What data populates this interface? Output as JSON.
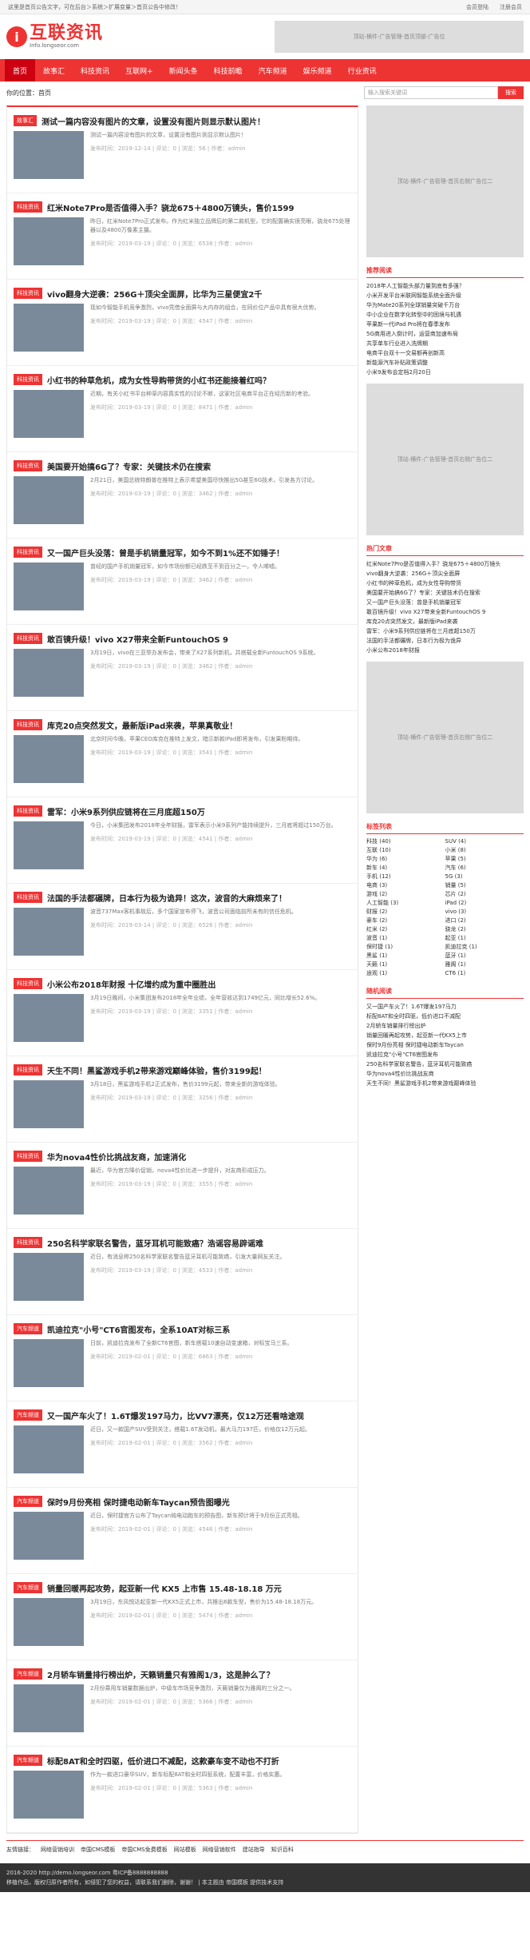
{
  "topbar": {
    "left": "这里是首页公告文字，可在后台＞系统＞扩展变量＞首页公告中修改！",
    "login": "会员登陆",
    "reg": "注册会员"
  },
  "logo": {
    "mark": "i",
    "cn": "互联资讯",
    "en": "Info.longseor.com"
  },
  "ads": {
    "top": "顶站-横件-广告管理-首页顶部-广告位",
    "side": "顶站-横件-广告管理-首页右侧广告位二"
  },
  "nav": [
    "首页",
    "故事汇",
    "科技资讯",
    "互联网+",
    "新闻头条",
    "科技前瞻",
    "汽车频道",
    "娱乐频道",
    "行业资讯"
  ],
  "bread": "你的位置：首页",
  "search": {
    "placeholder": "输入搜索关键词",
    "button": "搜索"
  },
  "articles": [
    {
      "badge": "故事汇",
      "title": "测试一篇内容没有图片的文章，设置没有图片则显示默认图片！",
      "desc": "测试一篇内容没有图片的文章，设置没有图片则显示默认图片！",
      "meta": "发布时间：2019-12-14 | 评论：0 | 浏览：56 | 作者：admin"
    },
    {
      "badge": "科技资讯",
      "title": "红米Note7Pro是否值得入手？骁龙675＋4800万镜头，售价1599",
      "desc": "昨日，红米Note7Pro正式发布。作为红米独立品牌后的第二款机型，它的配置确实很亮眼，骁龙675处理器以及4800万像素主摄。",
      "meta": "发布时间：2019-03-19 | 评论：0 | 浏览：6538 | 作者：admin"
    },
    {
      "badge": "科技资讯",
      "title": "vivo翻身大逆袭：256G＋顶尖全面屏，比华为三星便宜2千",
      "desc": "现如今智能手机竞争激烈，vivo凭借全面屏与大内存的组合，在同价位产品中具有很大优势。",
      "meta": "发布时间：2019-03-19 | 评论：0 | 浏览：4547 | 作者：admin"
    },
    {
      "badge": "科技资讯",
      "title": "小红书的种草危机，成为女性导购带货的小红书还能接着红吗？",
      "desc": "近期，有关小红书平台种草内容真实性的讨论不断，这家社区电商平台正在经历新的考验。",
      "meta": "发布时间：2019-03-19 | 评论：0 | 浏览：8471 | 作者：admin"
    },
    {
      "badge": "科技资讯",
      "title": "美国要开始搞6G了？专家：关键技术仍在搜索",
      "desc": "2月21日，美国总统特朗普在推特上表示希望美国尽快推出5G甚至6G技术，引发各方讨论。",
      "meta": "发布时间：2019-03-19 | 评论：0 | 浏览：3462 | 作者：admin"
    },
    {
      "badge": "科技资讯",
      "title": "又一国产巨头没落：曾是手机销量冠军，如今不到1%还不如锤子！",
      "desc": "曾经的国产手机销量冠军，如今市场份额已经跌至不到百分之一，令人唏嘘。",
      "meta": "发布时间：2019-03-19 | 评论：0 | 浏览：3462 | 作者：admin"
    },
    {
      "badge": "科技资讯",
      "title": "敢百镜升级！vivo X27带来全新FuntouchOS 9",
      "desc": "3月19日，vivo在三亚举办发布会，带来了X27系列新机，并搭载全新FuntouchOS 9系统。",
      "meta": "发布时间：2019-03-19 | 评论：0 | 浏览：3462 | 作者：admin"
    },
    {
      "badge": "科技资讯",
      "title": "库克20点突然发文，最新版iPad来袭，苹果真敬业！",
      "desc": "北京时间今晚，苹果CEO库克在推特上发文，暗示新款iPad即将发布，引发果粉期待。",
      "meta": "发布时间：2019-03-19 | 评论：0 | 浏览：3541 | 作者：admin"
    },
    {
      "badge": "科技资讯",
      "title": "雷军：小米9系列供应链将在三月底超150万",
      "desc": "今日，小米集团发布2018年全年财报，雷军表示小米9系列产能持续提升，三月底将超过150万台。",
      "meta": "发布时间：2019-03-19 | 评论：0 | 浏览：4541 | 作者：admin"
    },
    {
      "badge": "科技资讯",
      "title": "法国的手法都碾牌，日本行为极为诡异！这次，波音的大麻烦来了！",
      "desc": "波音737Max客机事故后，多个国家宣布停飞，波音公司面临前所未有的信任危机。",
      "meta": "发布时间：2019-03-14 | 评论：0 | 浏览：6526 | 作者：admin"
    },
    {
      "badge": "科技资讯",
      "title": "小米公布2018年财报 十亿增约成为重中圈胜出",
      "desc": "3月19日晚间，小米集团发布2018年全年业绩，全年营收达到1749亿元，同比增长52.6%。",
      "meta": "发布时间：2019-03-19 | 评论：0 | 浏览：3351 | 作者：admin"
    },
    {
      "badge": "科技资讯",
      "title": "天生不同！黑鲨游戏手机2带来游戏巅峰体验，售价3199起！",
      "desc": "3月18日，黑鲨游戏手机2正式发布，售价3199元起，带来全新的游戏体验。",
      "meta": "发布时间：2019-03-19 | 评论：0 | 浏览：3256 | 作者：admin"
    },
    {
      "badge": "科技资讯",
      "title": "华为nova4性价比挑战友商，加速消化",
      "desc": "最近，华为官方降价促销，nova4性价比进一步提升，对友商形成压力。",
      "meta": "发布时间：2019-03-19 | 评论：0 | 浏览：3555 | 作者：admin"
    },
    {
      "badge": "科技资讯",
      "title": "250名科学家联名警告，蓝牙耳机可能致癌？浩谣容易辟谣难",
      "desc": "近日，有消息称250名科学家联名警告蓝牙耳机可能致癌，引发大量网友关注。",
      "meta": "发布时间：2019-03-19 | 评论：0 | 浏览：4533 | 作者：admin"
    },
    {
      "badge": "汽车频道",
      "title": "凯迪拉克\"小号\"CT6官图发布，全系10AT对标三系",
      "desc": "日前，凯迪拉克发布了全新CT6官图，新车搭载10速自动变速箱，对标宝马三系。",
      "meta": "发布时间：2019-02-01 | 评论：0 | 浏览：6863 | 作者：admin"
    },
    {
      "badge": "汽车频道",
      "title": "又一国产车火了！1.6T爆发197马力，比VV7漂亮，仅12万还看啥途观",
      "desc": "近日，又一款国产SUV受到关注，搭载1.6T发动机，最大马力197匹，价格仅12万元起。",
      "meta": "发布时间：2019-02-01 | 评论：0 | 浏览：3562 | 作者：admin"
    },
    {
      "badge": "汽车频道",
      "title": "保时9月份亮相 保时捷电动新车Taycan预告图曝光",
      "desc": "近日，保时捷官方公布了Taycan纯电动跑车的预告图，新车预计将于9月份正式亮相。",
      "meta": "发布时间：2019-02-01 | 评论：0 | 浏览：4546 | 作者：admin"
    },
    {
      "badge": "汽车频道",
      "title": "销量回暖再起攻势，起亚新一代 KX5 上市售 15.48-18.18 万元",
      "desc": "3月19日，东风悦达起亚新一代KX5正式上市，共推出6款车型，售价为15.48-18.18万元。",
      "meta": "发布时间：2019-02-01 | 评论：0 | 浏览：5474 | 作者：admin"
    },
    {
      "badge": "汽车频道",
      "title": "2月轿车销量排行榜出炉，天籁销量只有雅阁1/3，这是肿么了？",
      "desc": "2月份乘用车销量数据出炉，中级车市场竞争激烈，天籁销量仅为雅阁的三分之一。",
      "meta": "发布时间：2019-02-01 | 评论：0 | 浏览：5366 | 作者：admin"
    },
    {
      "badge": "汽车频道",
      "title": "标配8AT和全时四驱，低价进口不减配，这款豪车变不动也不打折",
      "desc": "作为一款进口豪华SUV，新车标配8AT和全时四驱系统，配置丰富，价格实惠。",
      "meta": "发布时间：2019-02-01 | 评论：0 | 浏览：5363 | 作者：admin"
    }
  ],
  "side": {
    "recommend_title": "推荐阅读",
    "recommend": [
      "2018年人工智能头部力量到底有多强？",
      "小米开发平台米联网智能系统全面升级",
      "华为Mate20系列全球销量突破千万台",
      "中小企业在数字化转型中的困境与机遇",
      "苹果新一代iPad Pro将在春季发布",
      "5G商用进入倒计时，运营商加速布局",
      "共享单车行业进入洗牌期",
      "电商平台双十一交易额再创新高",
      "新能源汽车补贴政策调整",
      "小米9发布会定档2月20日"
    ],
    "hot_title": "热门文章",
    "hot": [
      "红米Note7Pro是否值得入手？骁龙675＋4800万镜头",
      "vivo翻身大逆袭：256G＋顶尖全面屏",
      "小红书的种草危机，成为女性导购带货",
      "美国要开始搞6G了？专家：关键技术仍在搜索",
      "又一国产巨头没落：曾是手机销量冠军",
      "敢百镜升级！vivo X27带来全新FuntouchOS 9",
      "库克20点突然发文，最新版iPad来袭",
      "雷军：小米9系列供应链将在三月底超150万",
      "法国的手法都碾牌，日本行为极为诡异",
      "小米公布2018年财报"
    ],
    "tags_title": "标签列表",
    "tags": [
      "科技 (40)",
      "SUV (4)",
      "互联 (10)",
      "小米 (8)",
      "华为 (6)",
      "苹果 (5)",
      "新车 (4)",
      "汽车 (6)",
      "手机 (12)",
      "5G (3)",
      "电商 (3)",
      "销量 (5)",
      "游戏 (2)",
      "芯片 (2)",
      "人工智能 (3)",
      "iPad (2)",
      "财报 (2)",
      "vivo (3)",
      "豪车 (2)",
      "进口 (2)",
      "红米 (2)",
      "骁龙 (2)",
      "波音 (1)",
      "起亚 (1)",
      "保时捷 (1)",
      "凯迪拉克 (1)",
      "黑鲨 (1)",
      "蓝牙 (1)",
      "天籁 (1)",
      "雅阁 (1)",
      "途观 (1)",
      "CT6 (1)"
    ],
    "random_title": "随机阅读",
    "random": [
      "又一国产车火了！1.6T爆发197马力",
      "标配8AT和全时四驱，低价进口不减配",
      "2月轿车销量排行榜出炉",
      "销量回暖再起攻势，起亚新一代KX5上市",
      "保时9月份亮相 保时捷电动新车Taycan",
      "凯迪拉克\"小号\"CT6官图发布",
      "250名科学家联名警告，蓝牙耳机可能致癌",
      "华为nova4性价比挑战友商",
      "天生不同！黑鲨游戏手机2带来游戏巅峰体验"
    ]
  },
  "friend": {
    "label": "友情链接：",
    "links": [
      "网络营销培训",
      "帝国CMS模板",
      "帝国CMS免费模板",
      "网站模板",
      "网络营销软件",
      "建站指导",
      "知识百科"
    ]
  },
  "footer": {
    "l1": "2016-2020 http://demo.longseor.com 粤ICP备8888888888",
    "l2": "移植作品，版权归原作者所有，如侵犯了您的权益，请联系我们删除，谢谢！ | 本主题由 帝国模板 提供技术支持"
  }
}
